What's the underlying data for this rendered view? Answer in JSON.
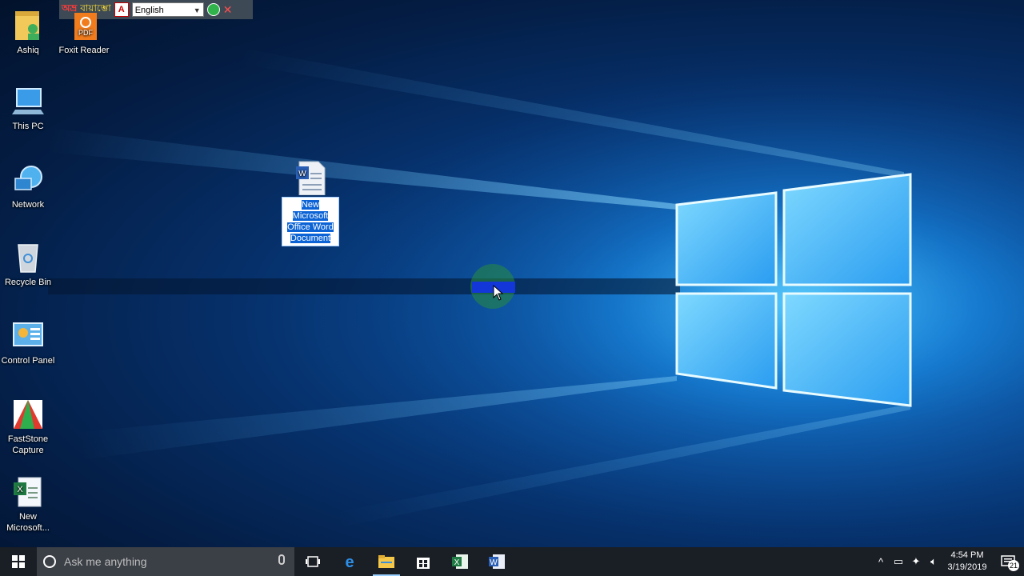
{
  "keyboard_bar": {
    "logo_text": "অভ্র",
    "bangla_text": "বায়াম্ভো",
    "pdf_label": "A",
    "layout_value": "English"
  },
  "desktop_icons": [
    {
      "label": "Ashiq",
      "icon": "user-folder-icon"
    },
    {
      "label": "Foxit Reader",
      "icon": "foxit-pdf-icon"
    },
    {
      "label": "This PC",
      "icon": "computer-icon"
    },
    {
      "label": "Network",
      "icon": "network-icon"
    },
    {
      "label": "Recycle Bin",
      "icon": "recycle-bin-icon"
    },
    {
      "label": "Control Panel",
      "icon": "control-panel-icon"
    },
    {
      "label": "FastStone Capture",
      "icon": "faststone-icon"
    },
    {
      "label": "New Microsoft...",
      "icon": "excel-file-icon"
    }
  ],
  "selected_file": {
    "label_lines": [
      "New",
      "Microsoft",
      "Office Word",
      "Document"
    ],
    "icon": "word-document-icon"
  },
  "taskbar": {
    "search_placeholder": "Ask me anything",
    "apps": [
      "task-view",
      "edge",
      "file-explorer",
      "store",
      "excel",
      "word"
    ],
    "clock_time": "4:54 PM",
    "clock_date": "3/19/2019",
    "notification_count": "21"
  },
  "colors": {
    "taskbar_bg": "#1a1e25",
    "search_bg": "#3b3f46",
    "selection_blue": "#0b63d6"
  }
}
